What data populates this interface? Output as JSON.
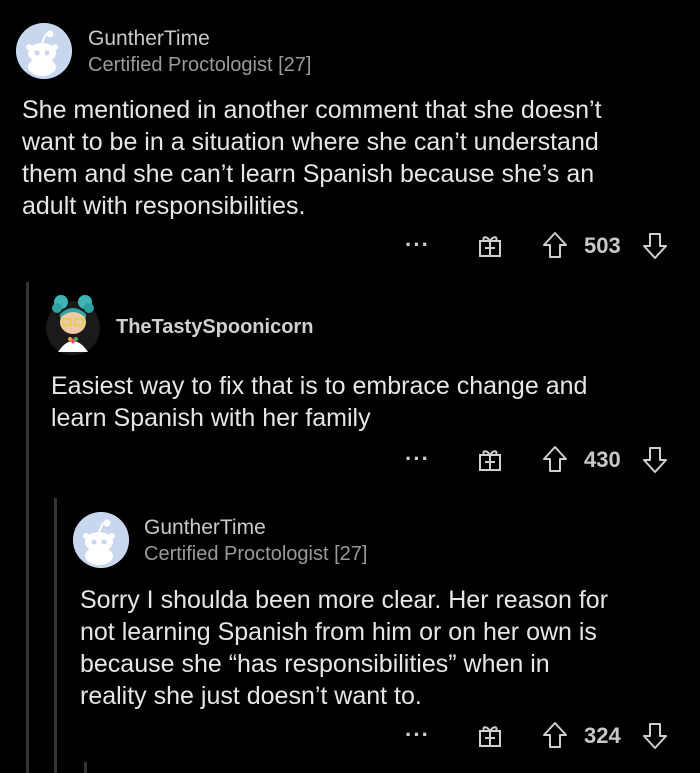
{
  "comments": [
    {
      "username": "GuntherTime",
      "flair": "Certified Proctologist [27]",
      "lines": [
        "She mentioned in another comment that she doesn’t",
        "want to be in a situation where she can’t understand",
        "them and she can’t learn Spanish because she’s an",
        "adult with responsibilities."
      ],
      "score": "503",
      "more_label": "···"
    },
    {
      "username": "TheTastySpoonicorn",
      "flair": "",
      "lines": [
        "Easiest way to fix that is to embrace change and",
        "learn Spanish with her family"
      ],
      "score": "430",
      "more_label": "···"
    },
    {
      "username": "GuntherTime",
      "flair": "Certified Proctologist [27]",
      "lines": [
        "Sorry I shoulda been more clear. Her reason for",
        "not learning Spanish from him or on her own is",
        "because she “has responsibilities” when in",
        "reality she just doesn’t want to."
      ],
      "score": "324",
      "more_label": "···"
    }
  ],
  "colors": {
    "background": "#000000",
    "text": "#e6e6e6",
    "muted": "#9a9a9a",
    "snoo_bg": "#c8d6ee"
  },
  "icons": [
    "reddit-snoo-avatar-icon",
    "custom-avatar-icon",
    "more-options-icon",
    "award-icon",
    "upvote-arrow-icon",
    "downvote-arrow-icon"
  ]
}
